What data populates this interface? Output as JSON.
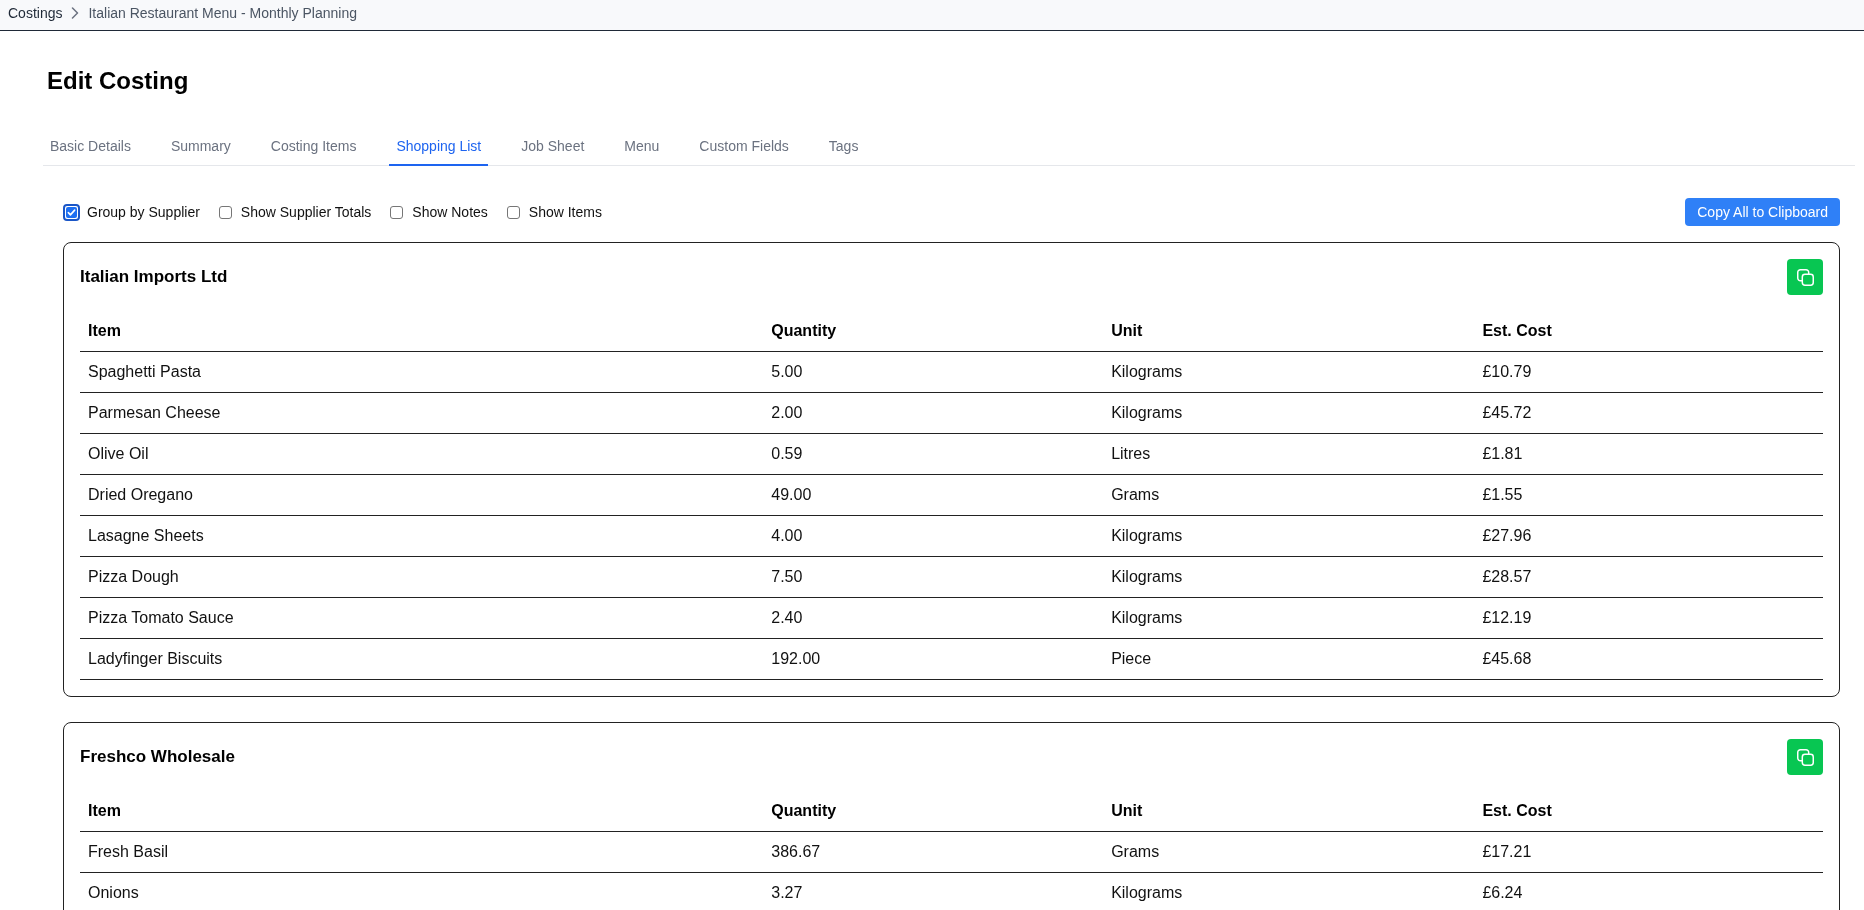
{
  "breadcrumb": {
    "items": [
      {
        "label": "Costings"
      },
      {
        "label": "Italian Restaurant Menu - Monthly Planning"
      }
    ]
  },
  "page_title": "Edit Costing",
  "tabs": [
    {
      "label": "Basic Details",
      "selected": false
    },
    {
      "label": "Summary",
      "selected": false
    },
    {
      "label": "Costing Items",
      "selected": false
    },
    {
      "label": "Shopping List",
      "selected": true
    },
    {
      "label": "Job Sheet",
      "selected": false
    },
    {
      "label": "Menu",
      "selected": false
    },
    {
      "label": "Custom Fields",
      "selected": false
    },
    {
      "label": "Tags",
      "selected": false
    }
  ],
  "options": [
    {
      "label": "Group by Supplier",
      "checked": true
    },
    {
      "label": "Show Supplier Totals",
      "checked": false
    },
    {
      "label": "Show Notes",
      "checked": false
    },
    {
      "label": "Show Items",
      "checked": false
    }
  ],
  "copy_all_button": {
    "label": "Copy All to Clipboard"
  },
  "suppliers": [
    {
      "name": "Italian Imports Ltd",
      "columns": [
        "Item",
        "Quantity",
        "Unit",
        "Est. Cost"
      ],
      "rows": [
        [
          "Spaghetti Pasta",
          "5.00",
          "Kilograms",
          "£10.79"
        ],
        [
          "Parmesan Cheese",
          "2.00",
          "Kilograms",
          "£45.72"
        ],
        [
          "Olive Oil",
          "0.59",
          "Litres",
          "£1.81"
        ],
        [
          "Dried Oregano",
          "49.00",
          "Grams",
          "£1.55"
        ],
        [
          "Lasagne Sheets",
          "4.00",
          "Kilograms",
          "£27.96"
        ],
        [
          "Pizza Dough",
          "7.50",
          "Kilograms",
          "£28.57"
        ],
        [
          "Pizza Tomato Sauce",
          "2.40",
          "Kilograms",
          "£12.19"
        ],
        [
          "Ladyfinger Biscuits",
          "192.00",
          "Piece",
          "£45.68"
        ]
      ]
    },
    {
      "name": "Freshco Wholesale",
      "columns": [
        "Item",
        "Quantity",
        "Unit",
        "Est. Cost"
      ],
      "rows": [
        [
          "Fresh Basil",
          "386.67",
          "Grams",
          "£17.21"
        ],
        [
          "Onions",
          "3.27",
          "Kilograms",
          "£6.24"
        ]
      ]
    }
  ]
}
